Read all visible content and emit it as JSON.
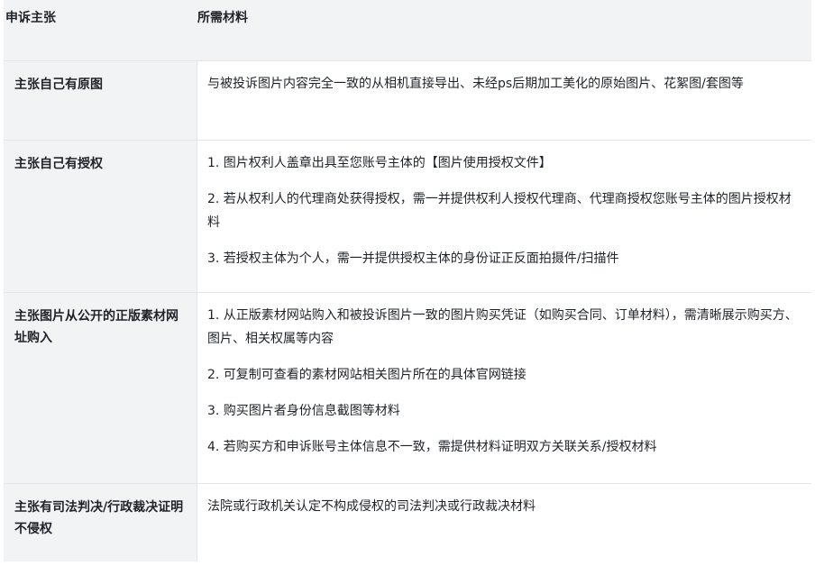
{
  "header": {
    "col1": "申诉主张",
    "col2": "所需材料"
  },
  "rows": [
    {
      "claim": "主张自己有原图",
      "materials": [
        "与被投诉图片内容完全一致的从相机直接导出、未经ps后期加工美化的原始图片、花絮图/套图等"
      ]
    },
    {
      "claim": "主张自己有授权",
      "materials": [
        "1. 图片权利人盖章出具至您账号主体的【图片使用授权文件】",
        "2. 若从权利人的代理商处获得授权，需一并提供权利人授权代理商、代理商授权您账号主体的图片授权材料",
        "3. 若授权主体为个人，需一并提供授权主体的身份证正反面拍摄件/扫描件"
      ]
    },
    {
      "claim": "主张图片从公开的正版素材网址购入",
      "materials": [
        "1. 从正版素材网站购入和被投诉图片一致的图片购买凭证（如购买合同、订单材料），需清晰展示购买方、图片、相关权属等内容",
        "2. 可复制可查看的素材网站相关图片所在的具体官网链接",
        "3. 购买图片者身份信息截图等材料",
        "4. 若购买方和申诉账号主体信息不一致，需提供材料证明双方关联关系/授权材料"
      ]
    },
    {
      "claim": "主张有司法判决/行政裁决证明不侵权",
      "materials": [
        "法院或行政机关认定不构成侵权的司法判决或行政裁决材料"
      ]
    }
  ]
}
